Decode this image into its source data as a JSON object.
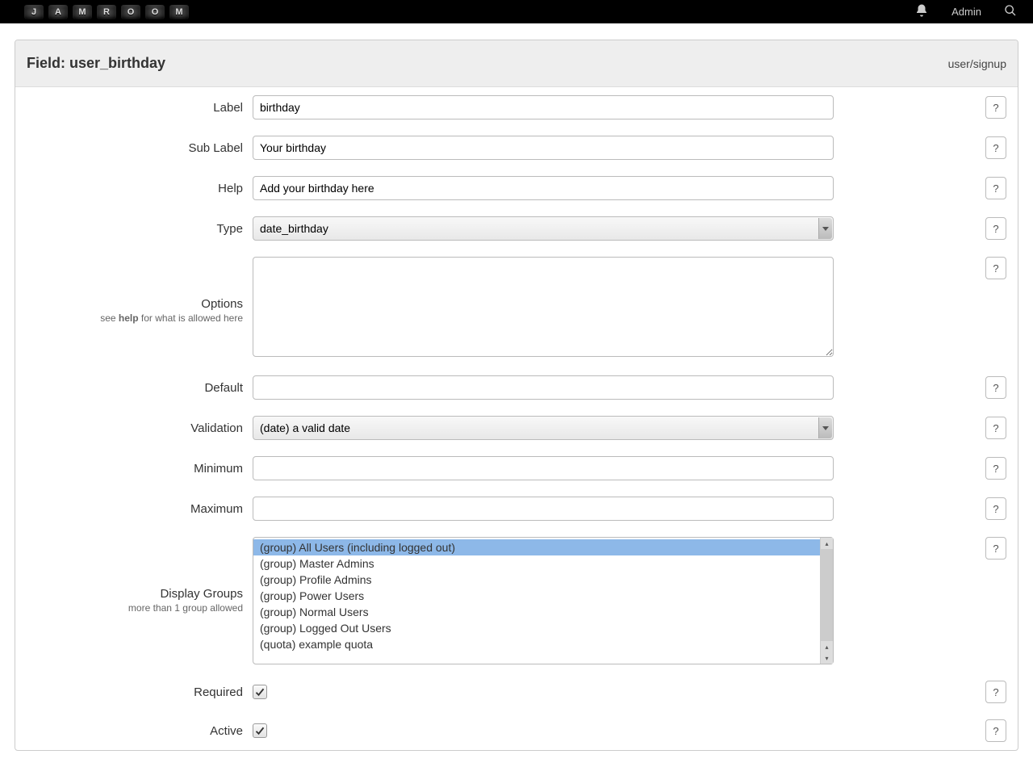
{
  "logo_letters": [
    "J",
    "A",
    "M",
    "R",
    "O",
    "O",
    "M"
  ],
  "topnav": {
    "items": [
      "Admin"
    ]
  },
  "panel": {
    "title": "Field: user_birthday",
    "crumb": "user/signup"
  },
  "fields": {
    "label": {
      "label": "Label",
      "value": "birthday"
    },
    "sublabel": {
      "label": "Sub Label",
      "value": "Your birthday"
    },
    "help": {
      "label": "Help",
      "value": "Add your birthday here"
    },
    "type": {
      "label": "Type",
      "value": "date_birthday"
    },
    "options": {
      "label": "Options",
      "sub_pre": "see ",
      "sub_bold": "help",
      "sub_post": " for what is allowed here",
      "value": ""
    },
    "default": {
      "label": "Default",
      "value": ""
    },
    "validation": {
      "label": "Validation",
      "value": "(date) a valid date"
    },
    "minimum": {
      "label": "Minimum",
      "value": ""
    },
    "maximum": {
      "label": "Maximum",
      "value": ""
    },
    "display_groups": {
      "label": "Display Groups",
      "sub": "more than 1 group allowed",
      "options": [
        "(group) All Users (including logged out)",
        "(group) Master Admins",
        "(group) Profile Admins",
        "(group) Power Users",
        "(group) Normal Users",
        "(group) Logged Out Users",
        "(quota) example quota"
      ],
      "selected_index": 0
    },
    "required": {
      "label": "Required",
      "checked": true
    },
    "active": {
      "label": "Active",
      "checked": true
    }
  },
  "help_button_label": "?"
}
